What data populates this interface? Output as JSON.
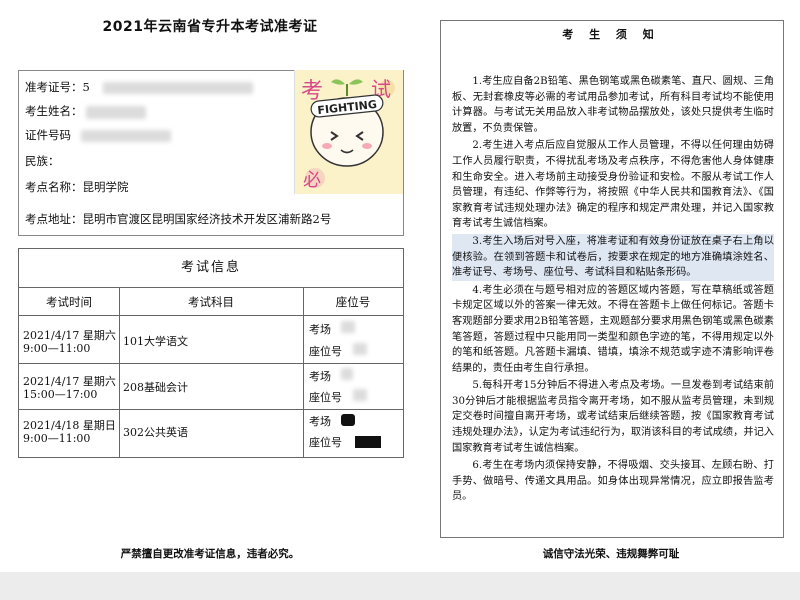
{
  "title": "2021年云南省专升本考试准考证",
  "info": {
    "ticket_label": "准考证号：",
    "ticket_value": "5",
    "name_label": "考生姓名：",
    "id_label": "证件号码",
    "nation_label": "民族：",
    "site_label": "考点名称：",
    "site_value": "昆明学院",
    "addr_label": "考点地址：",
    "addr_value": "昆明市官渡区昆明国家经济技术开发区浦新路2号"
  },
  "photo": {
    "text_top_left": "考",
    "text_top_right": "试",
    "badge": "FIGHTING",
    "text_bottom": "必"
  },
  "table": {
    "title": "考试信息",
    "headers": [
      "考试时间",
      "考试科目",
      "座位号"
    ],
    "rows": [
      {
        "date": "2021/4/17 星期六",
        "time": "9:00—11:00",
        "subject": "101大学语文",
        "room_label": "考场",
        "seat_label": "座位号"
      },
      {
        "date": "2021/4/17 星期六",
        "time": "15:00—17:00",
        "subject": "208基础会计",
        "room_label": "考场",
        "seat_label": "座位号"
      },
      {
        "date": "2021/4/18 星期日",
        "time": "9:00—11:00",
        "subject": "302公共英语",
        "room_label": "考场",
        "seat_label": "座位号"
      }
    ]
  },
  "footer_left": "严禁擅自更改准考证信息，违者必究。",
  "notice": {
    "title": "考 生 须 知",
    "items": [
      "1.考生应自备2B铅笔、黑色钢笔或黑色碳素笔、直尺、圆规、三角板、无封套橡皮等必需的考试用品参加考试，所有科目考试均不能使用计算器。与考试无关用品放入非考试物品摆放处，该处只提供考生临时放置，不负责保管。",
      "2.考生进入考点后应自觉服从工作人员管理，不得以任何理由妨碍工作人员履行职责，不得扰乱考场及考点秩序，不得危害他人身体健康和生命安全。进入考场前主动接受身份验证和安检。不服从考试工作人员管理，有违纪、作弊等行为，将按照《中华人民共和国教育法》、《国家教育考试违规处理办法》确定的程序和规定严肃处理，并记入国家教育考试考生诚信档案。",
      "3.考生入场后对号入座，将准考证和有效身份证放在桌子右上角以便核验。在领到答题卡和试卷后，按要求在规定的地方准确填涂姓名、准考证号、考场号、座位号、考试科目和粘贴条形码。",
      "4.考生必须在与题号相对应的答题区域内答题，写在草稿纸或答题卡规定区域以外的答案一律无效。不得在答题卡上做任何标记。答题卡客观题部分要求用2B铅笔答题，主观题部分要求用黑色钢笔或黑色碳素笔答题，答题过程中只能用同一类型和颜色字迹的笔，不得用规定以外的笔和纸答题。凡答题卡漏填、错填，填涂不规范或字迹不清影响评卷结果的，责任由考生自行承担。",
      "5.每科开考15分钟后不得进入考点及考场。一旦发卷到考试结束前30分钟后才能根据监考员指令离开考场，如不服从监考员管理，未到规定交卷时间擅自离开考场，或考试结束后继续答题，按《国家教育考试违规处理办法》，认定为考试违纪行为，取消该科目的考试成绩，并记入国家教育考试考生诚信档案。",
      "6.考生在考场内须保持安静，不得吸烟、交头接耳、左顾右盼、打手势、做暗号、传递文具用品。如身体出现异常情况，应立即报告监考员。"
    ]
  },
  "footer_right": "诚信守法光荣、违规舞弊可耻"
}
